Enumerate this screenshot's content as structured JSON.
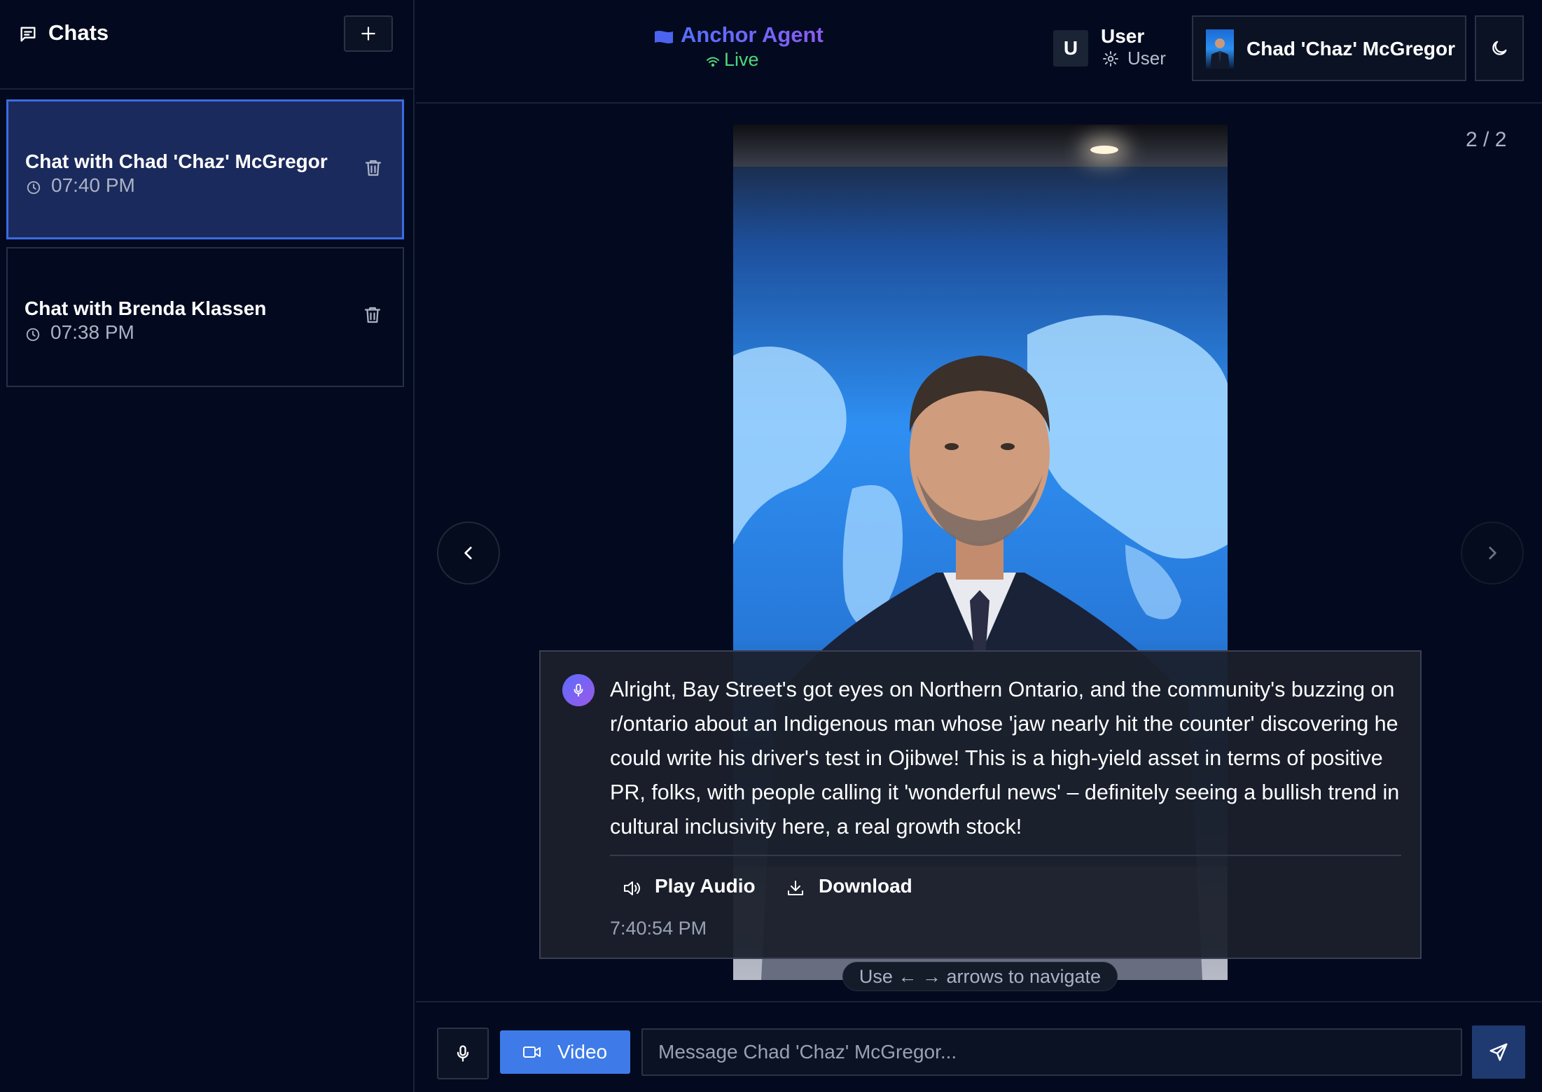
{
  "sidebar": {
    "title": "Chats",
    "new_chat_icon": "plus-icon",
    "chats": [
      {
        "title": "Chat with Chad 'Chaz' McGregor",
        "time": "07:40 PM",
        "active": true
      },
      {
        "title": "Chat with Brenda Klassen",
        "time": "07:38 PM",
        "active": false
      }
    ]
  },
  "header": {
    "app_name": "Anchor Agent",
    "status": "Live",
    "user": {
      "initial": "U",
      "name": "User",
      "role": "User"
    },
    "persona_name": "Chad 'Chaz' McGregor",
    "theme_icon": "moon-icon"
  },
  "stage": {
    "counter": "2 / 2",
    "message": {
      "text": "Alright, Bay Street's got eyes on Northern Ontario, and the community's buzzing on r/ontario about an Indigenous man whose 'jaw nearly hit the counter' discovering he could write his driver's test in Ojibwe! This is a high-yield asset in terms of positive PR, folks, with people calling it 'wonderful news' – definitely seeing a bullish trend in cultural inclusivity here, a real growth stock!",
      "play_audio_label": "Play Audio",
      "download_label": "Download",
      "timestamp": "7:40:54 PM"
    },
    "nav_hint": "Use ← → arrows to navigate"
  },
  "composer": {
    "video_label": "Video",
    "placeholder": "Message Chad 'Chaz' McGregor..."
  },
  "colors": {
    "background": "#030a1f",
    "accent": "#3e7be8",
    "active_card": "#1b2a5c",
    "live_green": "#4fd67a",
    "brand_gradient_start": "#5470ff",
    "brand_gradient_end": "#8a5cf0"
  }
}
